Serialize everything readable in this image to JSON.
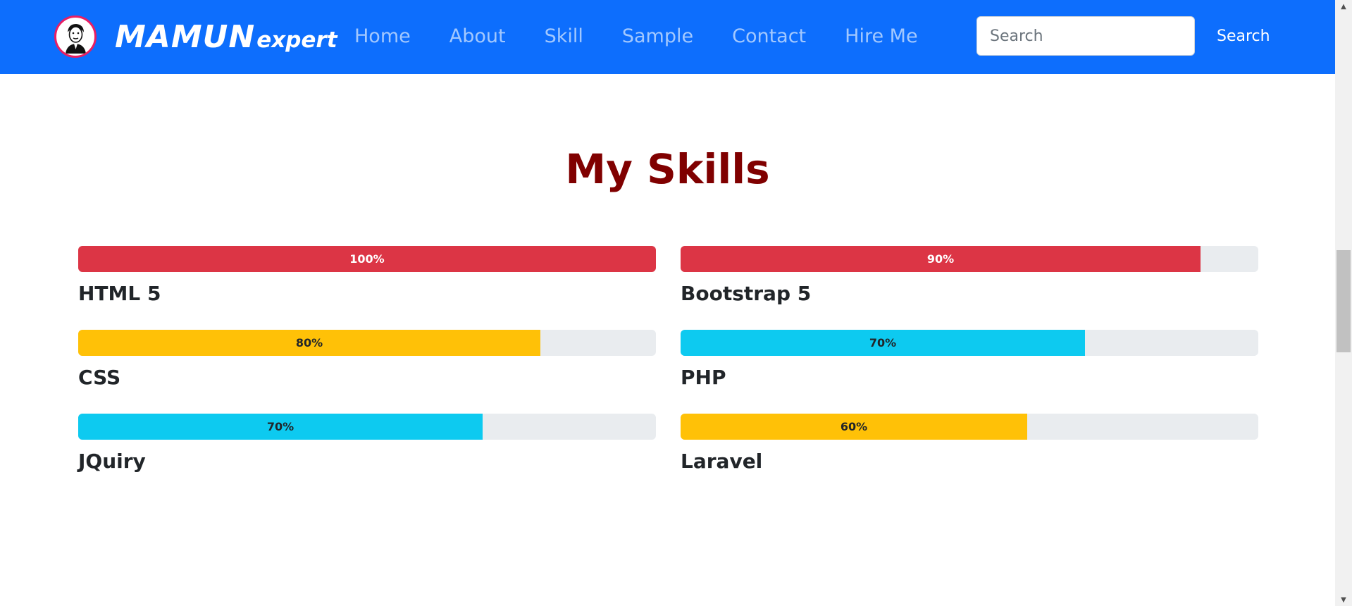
{
  "navbar": {
    "background": "#0d6efd",
    "logo_icon": "person-portrait-icon",
    "brand_main": "MAMUN",
    "brand_sub": "expert",
    "links": [
      "Home",
      "About",
      "Skill",
      "Sample",
      "Contact",
      "Hire Me"
    ],
    "search": {
      "placeholder": "Search",
      "value": "",
      "button_label": "Search"
    }
  },
  "section": {
    "title": "My Skills",
    "title_color": "#800000"
  },
  "skills": [
    {
      "name": "HTML 5",
      "percent": 100,
      "label": "100%",
      "color": "#dc3545",
      "text_color": "#ffffff"
    },
    {
      "name": "Bootstrap 5",
      "percent": 90,
      "label": "90%",
      "color": "#dc3545",
      "text_color": "#ffffff"
    },
    {
      "name": "CSS",
      "percent": 80,
      "label": "80%",
      "color": "#ffc107",
      "text_color": "#212529"
    },
    {
      "name": "PHP",
      "percent": 70,
      "label": "70%",
      "color": "#0dcaf0",
      "text_color": "#212529"
    },
    {
      "name": "JQuiry",
      "percent": 70,
      "label": "70%",
      "color": "#0dcaf0",
      "text_color": "#212529"
    },
    {
      "name": "Laravel",
      "percent": 60,
      "label": "60%",
      "color": "#ffc107",
      "text_color": "#212529"
    }
  ]
}
